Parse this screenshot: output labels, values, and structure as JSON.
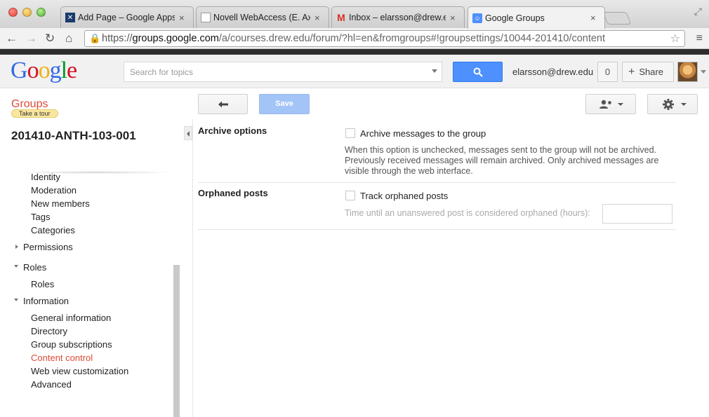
{
  "browser": {
    "tabs": [
      {
        "title": "Add Page – Google Apps In",
        "favicon": "xmark-logo-icon"
      },
      {
        "title": "Novell WebAccess (E. Axel",
        "favicon": "document-icon"
      },
      {
        "title": "Inbox – elarsson@drew.edu",
        "favicon": "gmail-icon"
      },
      {
        "title": "Google Groups",
        "favicon": "groups-icon"
      }
    ],
    "url_scheme": "https://",
    "url_host": "groups.google.com",
    "url_path": "/a/courses.drew.edu/forum/?hl=en&fromgroups#!groupsettings/10044-201410/content"
  },
  "header": {
    "logo": "Google",
    "search_placeholder": "Search for topics",
    "account": "elarsson@drew.edu",
    "notifications": "0",
    "share_label": "Share"
  },
  "groups_bar": {
    "app_name": "Groups",
    "tour_label": "Take a tour",
    "save_label": "Save"
  },
  "sidebar": {
    "group_name": "201410-ANTH-103-001",
    "items": [
      {
        "label": "Identity",
        "kind": "sub"
      },
      {
        "label": "Moderation",
        "kind": "sub"
      },
      {
        "label": "New members",
        "kind": "sub"
      },
      {
        "label": "Tags",
        "kind": "sub"
      },
      {
        "label": "Categories",
        "kind": "sub"
      },
      {
        "label": "Permissions",
        "kind": "section-collapsed"
      },
      {
        "label": "Roles",
        "kind": "section-expanded"
      },
      {
        "label": "Roles",
        "kind": "sub"
      },
      {
        "label": "Information",
        "kind": "section-expanded"
      },
      {
        "label": "General information",
        "kind": "sub"
      },
      {
        "label": "Directory",
        "kind": "sub"
      },
      {
        "label": "Group subscriptions",
        "kind": "sub"
      },
      {
        "label": "Content control",
        "kind": "sub-active"
      },
      {
        "label": "Web view customization",
        "kind": "sub"
      },
      {
        "label": "Advanced",
        "kind": "sub"
      }
    ]
  },
  "content": {
    "archive": {
      "label": "Archive options",
      "checkbox_label": "Archive messages to the group",
      "checked": false,
      "description_lines": [
        "When this option is unchecked, messages sent to the group will not be archived.",
        "Previously received messages will remain archived. Only archived messages are",
        "visible through the web interface."
      ]
    },
    "orphaned": {
      "label": "Orphaned posts",
      "checkbox_label": "Track orphaned posts",
      "checked": false,
      "hours_label": "Time until an unanswered post is considered orphaned (hours):",
      "hours_value": ""
    }
  },
  "colors": {
    "accent_blue": "#4d90fe",
    "groups_red": "#dd4b39"
  }
}
